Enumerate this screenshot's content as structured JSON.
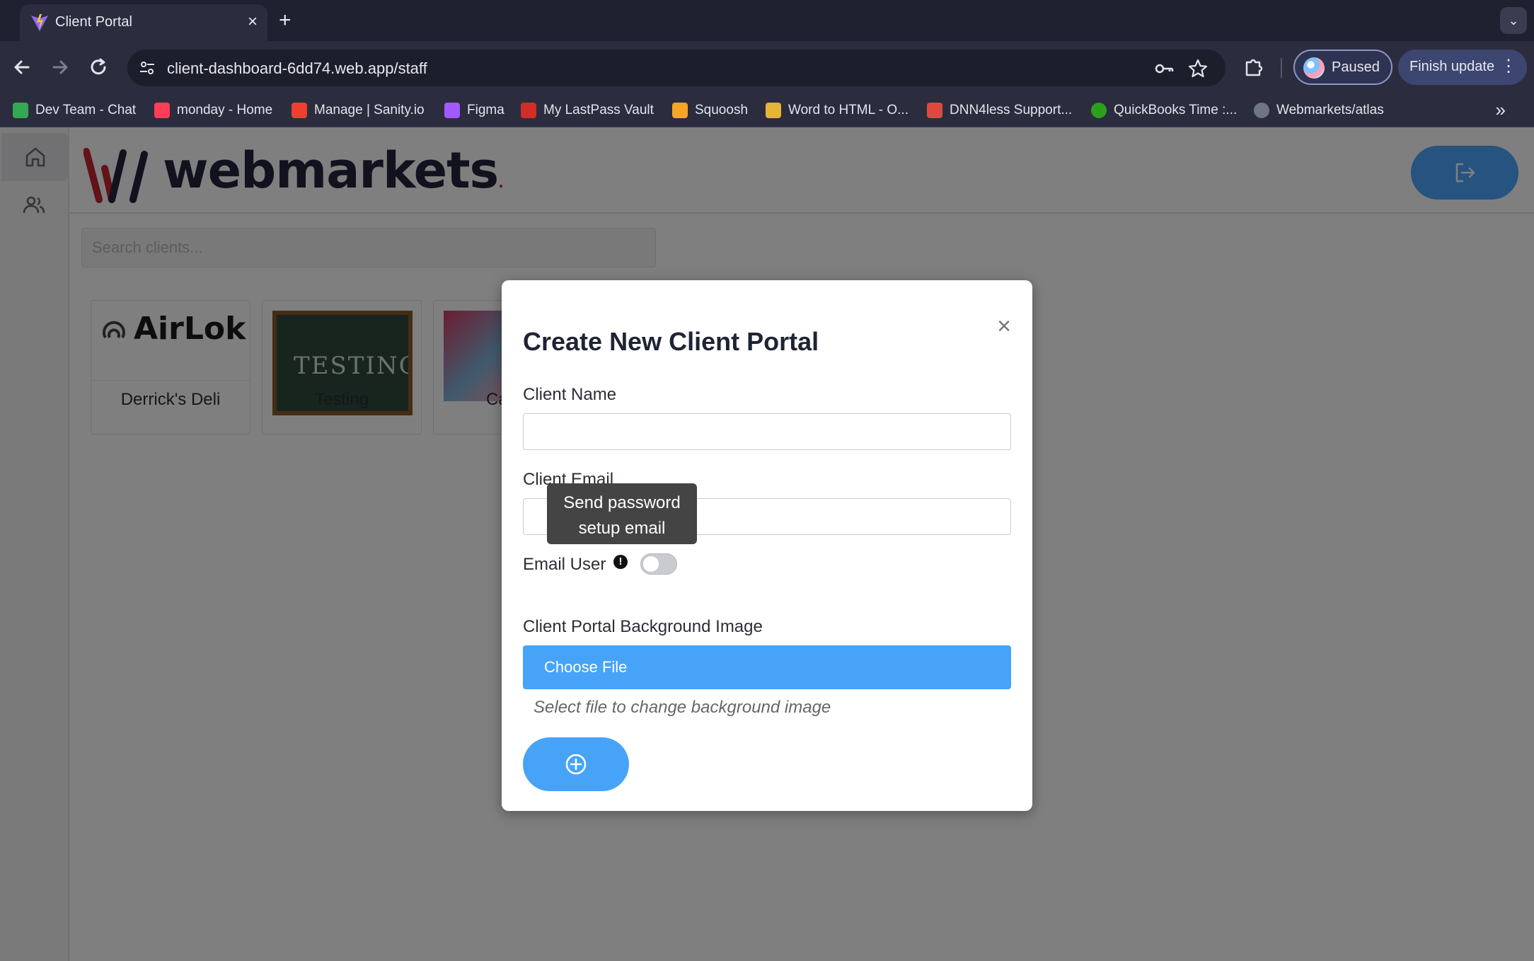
{
  "browser": {
    "tab_title": "Client Portal",
    "tab_close": "×",
    "new_tab": "+",
    "tab_menu": "⌄",
    "url": "client-dashboard-6dd74.web.app/staff",
    "profile_status": "Paused",
    "update_label": "Finish update",
    "menu_glyph": "⋮",
    "bookmarks": [
      {
        "label": "Dev Team - Chat",
        "color": "#34a853"
      },
      {
        "label": "monday - Home",
        "color": "#ff3d57"
      },
      {
        "label": "Manage | Sanity.io",
        "color": "#f03e2f"
      },
      {
        "label": "Figma",
        "color": "#a259ff"
      },
      {
        "label": "My LastPass Vault",
        "color": "#d32d27"
      },
      {
        "label": "Squoosh",
        "color": "#f5a623"
      },
      {
        "label": "Word to HTML - O...",
        "color": "#e8b339"
      },
      {
        "label": "DNN4less Support...",
        "color": "#e0483e"
      },
      {
        "label": "QuickBooks Time :...",
        "color": "#2ca01c"
      },
      {
        "label": "Webmarkets/atlas",
        "color": "#6e7681"
      }
    ],
    "bookmarks_more": "»"
  },
  "app": {
    "brand_name": "webmarkets",
    "brand_dot": ".",
    "search_placeholder": "Search clients...",
    "cards": [
      {
        "name": "Derrick's Deli",
        "image_text": "AirLok"
      },
      {
        "name": "Testing",
        "image_text": "TESTING"
      },
      {
        "name": "Ca"
      }
    ]
  },
  "modal": {
    "title": "Create New Client Portal",
    "close_glyph": "×",
    "client_name_label": "Client Name",
    "client_name_value": "",
    "client_email_label": "Client Email",
    "client_email_value": "",
    "tooltip_line1": "Send password",
    "tooltip_line2": "setup email",
    "email_user_label": "Email User",
    "info_glyph": "!",
    "email_user_enabled": false,
    "bg_image_label": "Client Portal Background Image",
    "choose_file_label": "Choose File",
    "file_hint": "Select file to change background image"
  },
  "colors": {
    "accent": "#46a3f8",
    "brand_red": "#c4262e",
    "brand_navy": "#23243a",
    "chrome_bg": "#2b2d3f"
  }
}
